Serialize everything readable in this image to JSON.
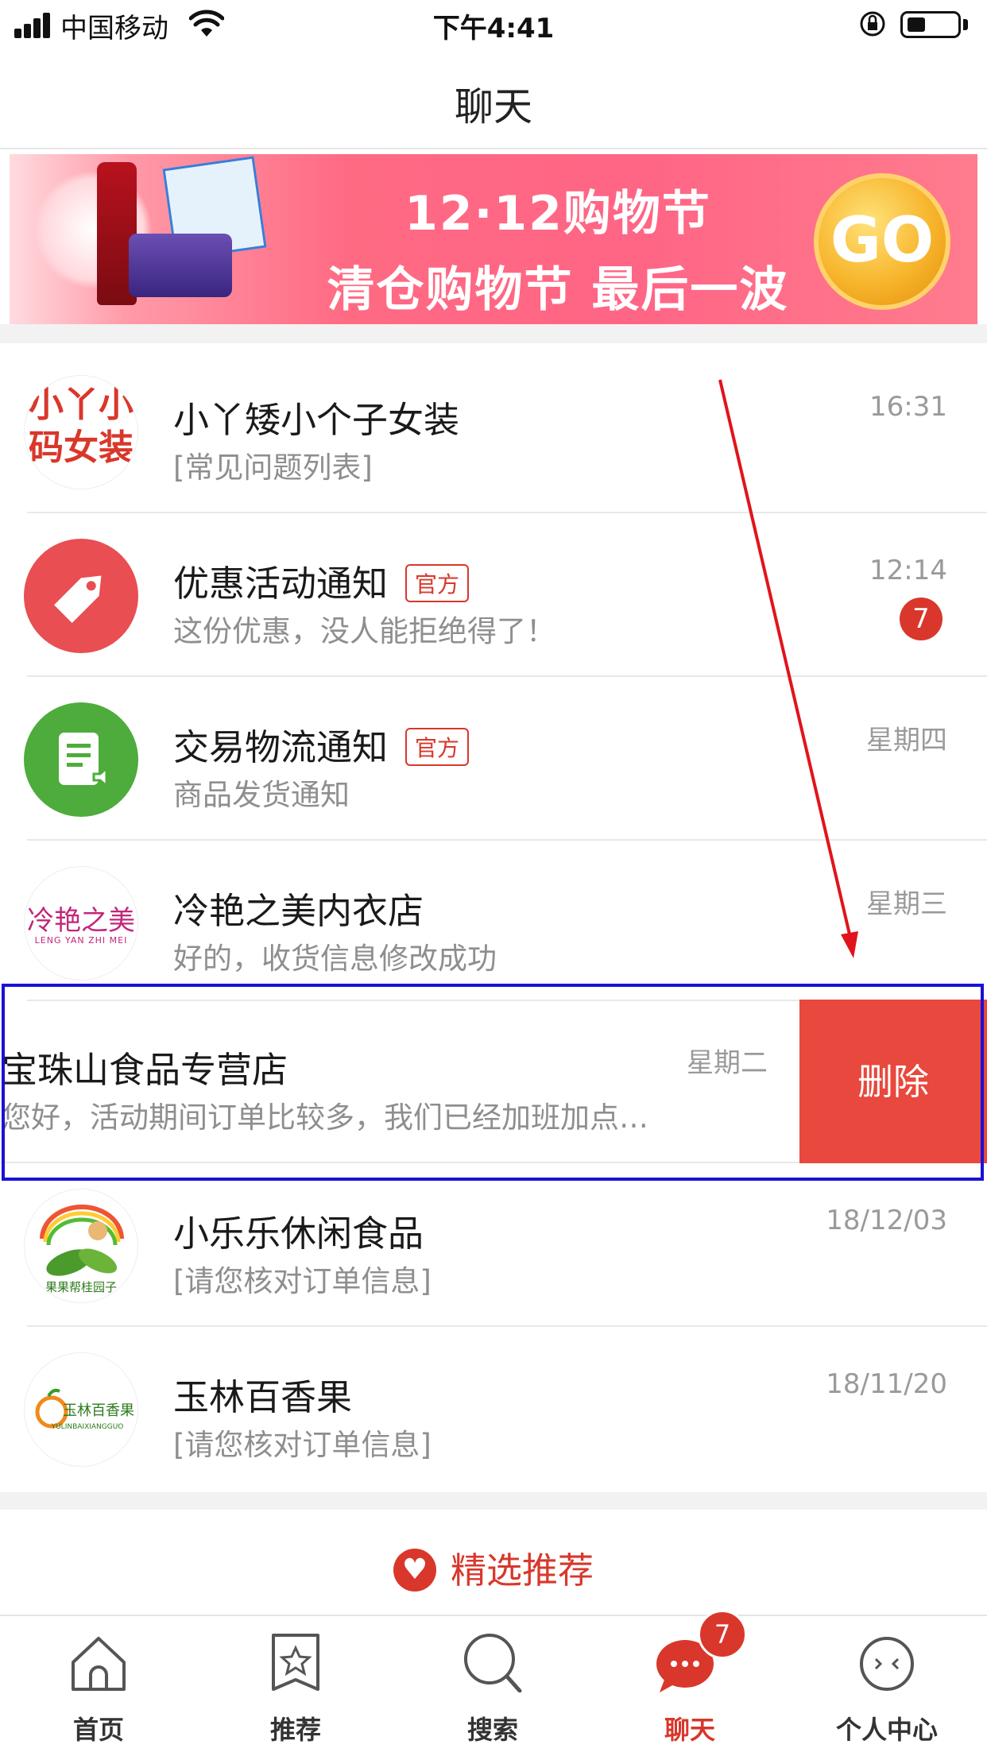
{
  "status_bar": {
    "carrier": "中国移动",
    "time": "下午4:41"
  },
  "nav": {
    "title": "聊天"
  },
  "banner": {
    "line1": "12·12购物节",
    "line2": "清仓购物节 最后一波",
    "go": "GO"
  },
  "chats": [
    {
      "title": "小丫矮小个子女装",
      "subtitle": "[常见问题列表]",
      "time": "16:31",
      "avatar_text": "小丫小码女装"
    },
    {
      "title": "优惠活动通知",
      "official": "官方",
      "subtitle": "这份优惠，没人能拒绝得了！",
      "time": "12:14",
      "unread": "7"
    },
    {
      "title": "交易物流通知",
      "official": "官方",
      "subtitle": "商品发货通知",
      "time": "星期四"
    },
    {
      "title": "冷艳之美内衣店",
      "subtitle": "好的，收货信息修改成功",
      "time": "星期三",
      "avatar_text": "冷艳之美",
      "avatar_sub": "LENG YAN ZHI MEI"
    },
    {
      "title": "宝珠山食品专营店",
      "subtitle": "您好，活动期间订单比较多，我们已经加班加点…",
      "time": "星期二",
      "delete_label": "删除"
    },
    {
      "title": "小乐乐休闲食品",
      "subtitle": "[请您核对订单信息]",
      "time": "18/12/03",
      "avatar_text": "果果帮桂园子"
    },
    {
      "title": "玉林百香果",
      "subtitle": "[请您核对订单信息]",
      "time": "18/11/20",
      "avatar_text": "玉林百香果",
      "avatar_sub": "YULINBAIXIANGGUO"
    }
  ],
  "recommend": {
    "label": "精选推荐"
  },
  "tabs": [
    {
      "label": "首页",
      "icon": "home-icon"
    },
    {
      "label": "推荐",
      "icon": "star-bookmark-icon"
    },
    {
      "label": "搜索",
      "icon": "search-icon"
    },
    {
      "label": "聊天",
      "icon": "chat-icon",
      "badge": "7",
      "active": true
    },
    {
      "label": "个人中心",
      "icon": "profile-icon"
    }
  ],
  "colors": {
    "accent": "#d9372b",
    "delete": "#e8483d",
    "highlight_frame": "#1a10d8",
    "annotation_arrow": "#e0141c"
  }
}
